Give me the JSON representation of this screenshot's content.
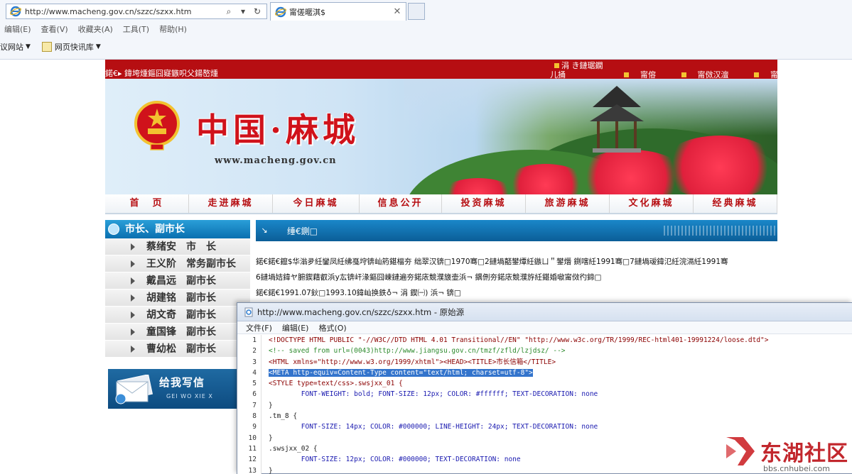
{
  "browser": {
    "address_url": "http://www.macheng.gov.cn/szzc/szxx.htm",
    "tab_title": "甯傞暱淇$",
    "menu": [
      "编辑(E)",
      "查看(V)",
      "收藏夹(A)",
      "工具(T)",
      "帮助(H)"
    ],
    "favorites": [
      "议网站",
      "网页快讯库"
    ]
  },
  "site": {
    "topbar_left": "鍩€▸ 鍏垮煄鏂囧寲鏃呮父鍚嶅煄",
    "topbar_right_top": "涓   き鏈琚鐗",
    "topbar_right_bottom": "儿捅",
    "topbar_links": [
      "甯傛",
      "甯傚汉澶",
      "甯傛斂鍗"
    ],
    "banner_title": "中国·麻城",
    "banner_url": "www.macheng.gov.cn",
    "nav": [
      "首　页",
      "走进麻城",
      "今日麻城",
      "信息公开",
      "投资麻城",
      "旅游麻城",
      "文化麻城",
      "经典麻城"
    ],
    "left_panel_title": "市长、副市长",
    "leaders": [
      {
        "name": "蔡绪安",
        "position": "市　长"
      },
      {
        "name": "王义阶",
        "position": "常务副市长"
      },
      {
        "name": "戴昌远",
        "position": "副市长"
      },
      {
        "name": "胡建铭",
        "position": "副市长"
      },
      {
        "name": "胡文奇",
        "position": "副市长"
      },
      {
        "name": "童国锋",
        "position": "副市长"
      },
      {
        "name": "曹幼松",
        "position": "副市长"
      }
    ],
    "write_title": "给我写信",
    "write_sub": "GEI WO XIE X",
    "content_title": "缍€鍘□",
    "content_lines": [
      "鍩€鍩€鑹$华滃夛紝鑾凤紝绋戞垨锛屾箹鍖楅夯   绌翠汉锛□1970骞□2鏈堝嚭鐢燂紝鏃ㄩ＂鐢熸   鍘嗐紝1991骞□7鏈堝叆鍏氾紝浣滆紝1991骞",
      "6鏈堝姞鍏ヤ腑鍥藉叡浜у厷锛屽湪鏂囧崠鏈遍夯鍩庡競濮旇壶浜¬   鍝侀夯鍩庡競濮斿紝鍖婚噷甯傚彴鍗□",
      "鍩€鍩€1991.07鈥□1993.10鍏屾换鉄♁¬ 涓    鍥㈠) 浜¬ 锛□"
    ],
    "agency_label": ""
  },
  "source_window": {
    "title": "http://www.macheng.gov.cn/szzc/szxx.htm - 原始源",
    "menu": [
      "文件(F)",
      "编辑(E)",
      "格式(O)"
    ],
    "lines": [
      {
        "n": "1",
        "text": "<!DOCTYPE HTML PUBLIC \"-//W3C//DTD HTML 4.01 Transitional//EN\" \"http://www.w3c.org/TR/1999/REC-html401-19991224/loose.dtd\">"
      },
      {
        "n": "2",
        "text": "<!-- saved from url=(0043)http://www.jiangsu.gov.cn/tmzf/zfld/lzjdsz/ -->"
      },
      {
        "n": "3",
        "text": "<HTML xmlns=\"http://www.w3.org/1999/xhtml\"><HEAD><TITLE>市长信箱</TITLE>"
      },
      {
        "n": "4",
        "text": "<META http-equiv=Content-Type content=\"text/html; charset=utf-8\">"
      },
      {
        "n": "5",
        "text": "<STYLE type=text/css>.swsjxx_01 {"
      },
      {
        "n": "6",
        "text": "        FONT-WEIGHT: bold; FONT-SIZE: 12px; COLOR: #ffffff; TEXT-DECORATION: none"
      },
      {
        "n": "7",
        "text": "}"
      },
      {
        "n": "8",
        "text": ".tm_8 {"
      },
      {
        "n": "9",
        "text": "        FONT-SIZE: 14px; COLOR: #000000; LINE-HEIGHT: 24px; TEXT-DECORATION: none"
      },
      {
        "n": "10",
        "text": "}"
      },
      {
        "n": "11",
        "text": ".swsjxx_02 {"
      },
      {
        "n": "12",
        "text": "        FONT-SIZE: 12px; COLOR: #000000; TEXT-DECORATION: none"
      },
      {
        "n": "13",
        "text": "}"
      }
    ]
  },
  "watermark": {
    "title": "东湖社区",
    "url": "bbs.cnhubei.com"
  },
  "colors": {
    "site_red": "#b60e12",
    "panel_blue": "#0a6fb0",
    "selection_blue": "#3374cc"
  }
}
